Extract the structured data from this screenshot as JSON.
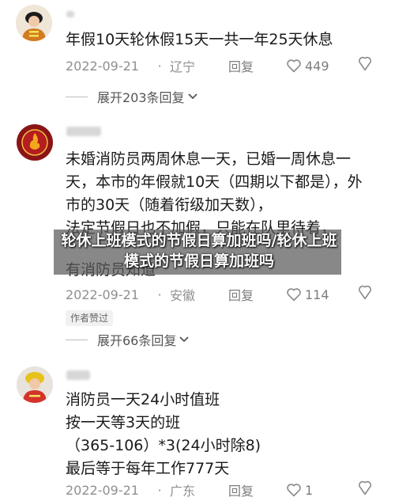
{
  "comments": [
    {
      "text": "年假10天轮休假15天一共一年25天休息",
      "date": "2022-09-21",
      "location": "辽宁",
      "reply_label": "回复",
      "likes": "449",
      "expand_label": "展开203条回复"
    },
    {
      "text": "未婚消防员两周休息一天，已婚一周休息一天，本市的年假就10天（四期以下都是），外市的30天（随着衔级加天数），",
      "text_under": "法定节假日也不加假，只能在队里待着，",
      "text_under2": "有消防员知道",
      "date": "2022-09-21",
      "location": "安徽",
      "reply_label": "回复",
      "likes": "114",
      "badge": "作者赞过",
      "expand_label": "展开66条回复"
    },
    {
      "text": "消防员一天24小时值班\n按一天等3天的班\n（365-106）*3(24小时除8)\n最后等于每年工作777天",
      "date": "2022-09-21",
      "location": "广东",
      "reply_label": "回复",
      "likes": "1"
    }
  ],
  "overlay": {
    "title": "轮休上班模式的节假日算加班吗/轮休上班模式的节假日算加班吗"
  }
}
